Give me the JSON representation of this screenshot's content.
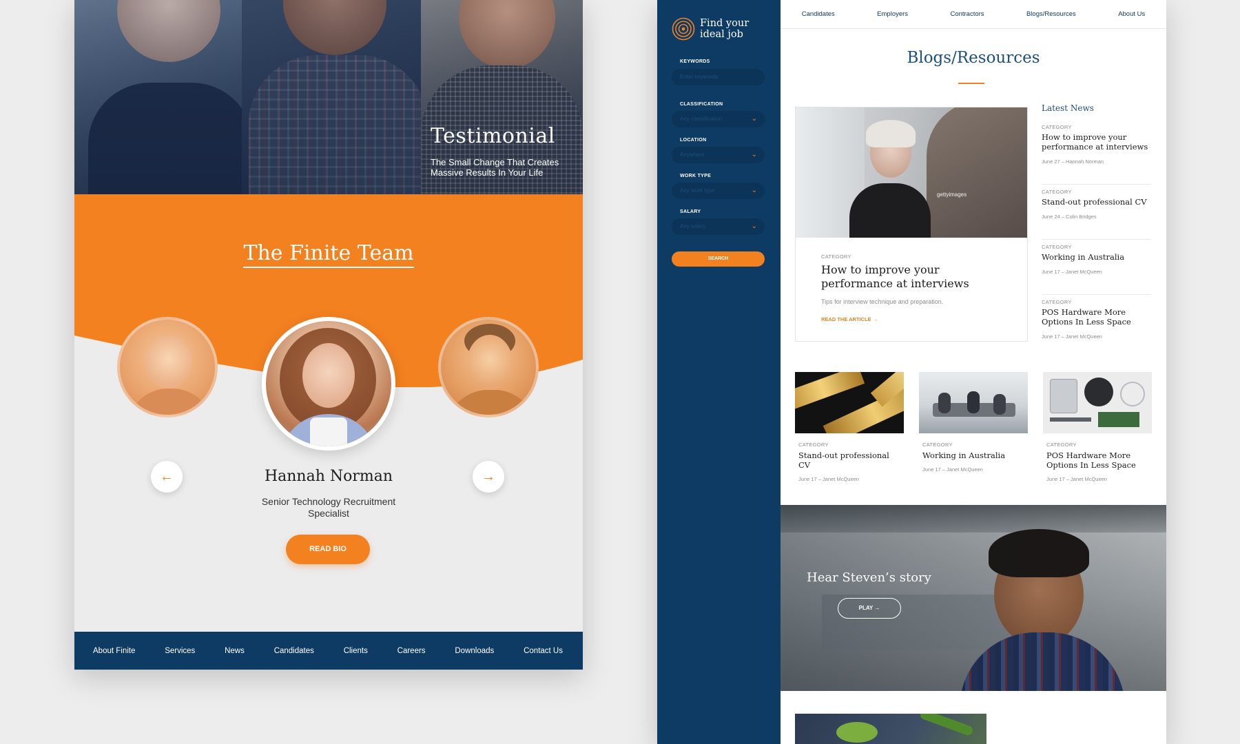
{
  "left": {
    "hero": {
      "title": "Testimonial",
      "subtitle": "The Small Change That Creates Massive Results In Your Life"
    },
    "team": {
      "title": "The Finite Team",
      "member_name": "Hannah Norman",
      "member_role": "Senior Technology Recruitment Specialist",
      "read_bio": "READ BIO",
      "prev_arrow": "←",
      "next_arrow": "→"
    },
    "footer_nav": [
      {
        "label": "About Finite"
      },
      {
        "label": "Services"
      },
      {
        "label": "News"
      },
      {
        "label": "Candidates"
      },
      {
        "label": "Clients"
      },
      {
        "label": "Careers"
      },
      {
        "label": "Downloads"
      },
      {
        "label": "Contact Us"
      }
    ],
    "colors": {
      "orange": "#f48120",
      "navy": "#0e3b63"
    }
  },
  "right": {
    "sidebar": {
      "logo_text": "Find your ideal job",
      "filters": [
        {
          "label": "KEYWORDS",
          "placeholder": "Enter keywords"
        },
        {
          "label": "CLASSIFICATION",
          "placeholder": "Any classification"
        },
        {
          "label": "LOCATION",
          "placeholder": "Anywhere"
        },
        {
          "label": "WORK TYPE",
          "placeholder": "Any work type"
        },
        {
          "label": "SALARY",
          "placeholder": "Any salary"
        }
      ],
      "search_label": "SEARCH"
    },
    "topnav": [
      {
        "label": "Candidates"
      },
      {
        "label": "Employers"
      },
      {
        "label": "Contractors"
      },
      {
        "label": "Blogs/Resources"
      },
      {
        "label": "About Us"
      }
    ],
    "page_title": "Blogs/Resources",
    "featured": {
      "category": "CATEGORY",
      "title": "How to improve your performance at interviews",
      "description": "Tips for interview technique and preparation.",
      "read_more": "READ THE ARTICLE →",
      "watermark": "gettyimages"
    },
    "latest": {
      "heading": "Latest News",
      "items": [
        {
          "category": "CATEGORY",
          "title": "How to improve your performance at interviews",
          "meta": "June 27 – Hannah Norman"
        },
        {
          "category": "CATEGORY",
          "title": "Stand-out professional CV",
          "meta": "June 24 – Colin Bridges"
        },
        {
          "category": "CATEGORY",
          "title": "Working in Australia",
          "meta": "June 17 – Janet McQueen"
        },
        {
          "category": "CATEGORY",
          "title": "POS Hardware More Options In Less Space",
          "meta": "June 17 – Janet McQueen"
        }
      ]
    },
    "cards": [
      {
        "category": "CATEGORY",
        "title": "Stand-out professional CV",
        "meta": "June 17 – Janet McQueen"
      },
      {
        "category": "CATEGORY",
        "title": "Working in Australia",
        "meta": "June 17 – Janet McQueen"
      },
      {
        "category": "CATEGORY",
        "title": "POS Hardware More Options In Less Space",
        "meta": "June 17 – Janet McQueen"
      }
    ],
    "story": {
      "title": "Hear Steven’s story",
      "play": "PLAY →"
    }
  }
}
